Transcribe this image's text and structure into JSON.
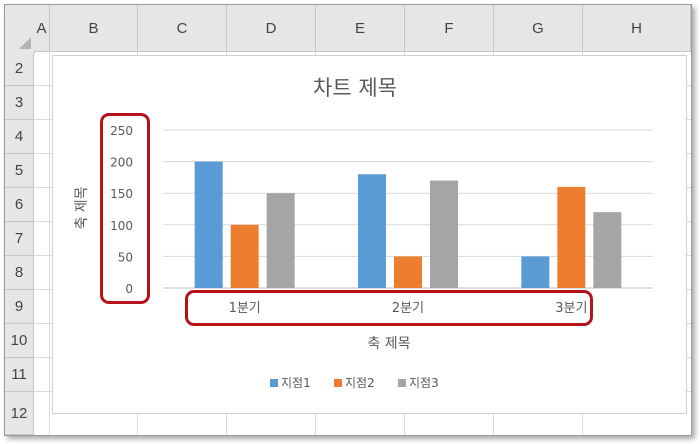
{
  "sheet": {
    "columns": [
      "A",
      "B",
      "C",
      "D",
      "E",
      "F",
      "G",
      "H"
    ],
    "rows": [
      "2",
      "3",
      "4",
      "5",
      "6",
      "7",
      "8",
      "9",
      "10",
      "11",
      "12"
    ]
  },
  "colors": {
    "series": [
      "#5b9bd5",
      "#ed7d31",
      "#a5a5a5"
    ],
    "highlight": "#b5121b"
  },
  "chart_data": {
    "type": "bar",
    "title": "차트 제목",
    "xlabel": "축 제목",
    "ylabel": "축 제목",
    "categories": [
      "1분기",
      "2분기",
      "3분기"
    ],
    "series": [
      {
        "name": "지점1",
        "values": [
          200,
          180,
          50
        ]
      },
      {
        "name": "지점2",
        "values": [
          100,
          50,
          160
        ]
      },
      {
        "name": "지점3",
        "values": [
          150,
          170,
          120
        ]
      }
    ],
    "ylim": [
      0,
      250
    ],
    "yticks": [
      "250",
      "200",
      "150",
      "100",
      "50",
      "0"
    ],
    "grid": true,
    "legend": "bottom"
  }
}
